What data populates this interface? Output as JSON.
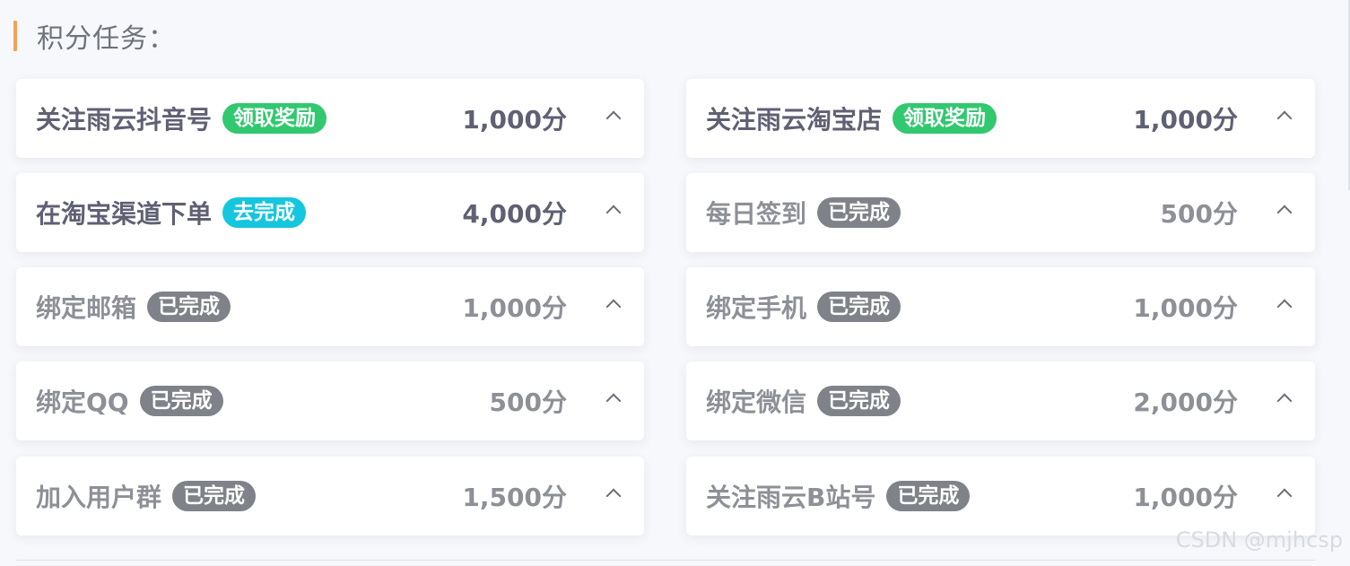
{
  "header": {
    "title": "积分任务："
  },
  "colors": {
    "accent": "#f2a25b",
    "tag_green": "#31c86f",
    "tag_cyan": "#14c6de",
    "tag_gray": "#7f8288",
    "text_dark": "#5f6073",
    "text_muted": "#8d9096"
  },
  "tasks": [
    {
      "name": "关注雨云抖音号",
      "tag": "领取奖励",
      "points": "1,000分"
    },
    {
      "name": "关注雨云淘宝店",
      "tag": "领取奖励",
      "points": "1,000分"
    },
    {
      "name": "在淘宝渠道下单",
      "tag": "去完成",
      "points": "4,000分"
    },
    {
      "name": "每日签到",
      "tag": "已完成",
      "points": "500分"
    },
    {
      "name": "绑定邮箱",
      "tag": "已完成",
      "points": "1,000分"
    },
    {
      "name": "绑定手机",
      "tag": "已完成",
      "points": "1,000分"
    },
    {
      "name": "绑定QQ",
      "tag": "已完成",
      "points": "500分"
    },
    {
      "name": "绑定微信",
      "tag": "已完成",
      "points": "2,000分"
    },
    {
      "name": "加入用户群",
      "tag": "已完成",
      "points": "1,500分"
    },
    {
      "name": "关注雨云B站号",
      "tag": "已完成",
      "points": "1,000分"
    }
  ],
  "watermark": "CSDN @mjhcsp"
}
